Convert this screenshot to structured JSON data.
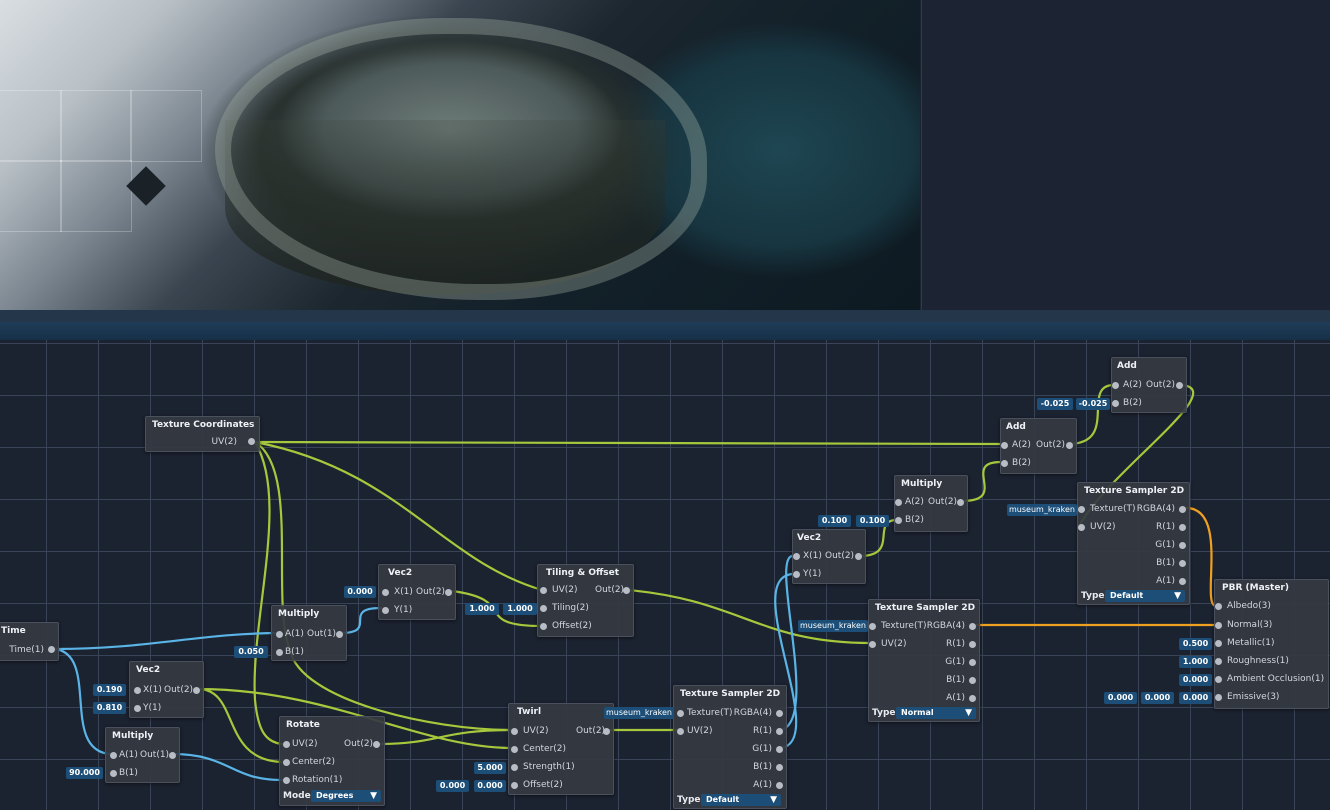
{
  "scene": {
    "viewport": "3D scene viewport"
  },
  "nodes": {
    "texcoords": {
      "title": "Texture Coordinates",
      "out": "UV(2)"
    },
    "time": {
      "title": "Time",
      "out": "Time(1)"
    },
    "vec2_a": {
      "title": "Vec2",
      "x": "X(1)",
      "y": "Y(1)",
      "out": "Out(2)",
      "x_val": "0.190",
      "y_val": "0.810"
    },
    "multiply_a": {
      "title": "Multiply",
      "a": "A(1)",
      "b": "B(1)",
      "out": "Out(1)",
      "b_val": "90.000"
    },
    "multiply_b": {
      "title": "Multiply",
      "a": "A(1)",
      "b": "B(1)",
      "out": "Out(1)",
      "b_val": "0.050"
    },
    "vec2_b": {
      "title": "Vec2",
      "x": "X(1)",
      "y": "Y(1)",
      "out": "Out(2)",
      "x_val": "0.000"
    },
    "rotate": {
      "title": "Rotate",
      "uv": "UV(2)",
      "center": "Center(2)",
      "rotation": "Rotation(1)",
      "out": "Out(2)",
      "mode_label": "Mode",
      "mode_value": "Degrees"
    },
    "tiling": {
      "title": "Tiling & Offset",
      "uv": "UV(2)",
      "tiling": "Tiling(2)",
      "offset": "Offset(2)",
      "out": "Out(2)",
      "tiling_x": "1.000",
      "tiling_y": "1.000"
    },
    "twirl": {
      "title": "Twirl",
      "uv": "UV(2)",
      "center": "Center(2)",
      "strength": "Strength(1)",
      "offset": "Offset(2)",
      "out": "Out(2)",
      "strength_val": "5.000",
      "offset_x": "0.000",
      "offset_y": "0.000"
    },
    "sampler_a": {
      "title": "Texture Sampler 2D",
      "texture": "Texture(T)",
      "uv": "UV(2)",
      "rgba": "RGBA(4)",
      "r": "R(1)",
      "g": "G(1)",
      "b": "B(1)",
      "a": "A(1)",
      "asset": "museum_kraken",
      "type_label": "Type",
      "type_value": "Default"
    },
    "vec2_c": {
      "title": "Vec2",
      "x": "X(1)",
      "y": "Y(1)",
      "out": "Out(2)"
    },
    "multiply_c": {
      "title": "Multiply",
      "a": "A(2)",
      "b": "B(2)",
      "out": "Out(2)",
      "a_val": "0.100",
      "b_val": "0.100"
    },
    "sampler_b": {
      "title": "Texture Sampler 2D",
      "texture": "Texture(T)",
      "uv": "UV(2)",
      "rgba": "RGBA(4)",
      "r": "R(1)",
      "g": "G(1)",
      "b": "B(1)",
      "a": "A(1)",
      "asset": "museum_kraken",
      "type_label": "Type",
      "type_value": "Normal"
    },
    "add_a": {
      "title": "Add",
      "a": "A(2)",
      "b": "B(2)",
      "out": "Out(2)"
    },
    "add_b": {
      "title": "Add",
      "a": "A(2)",
      "b": "B(2)",
      "out": "Out(2)",
      "a_val": "-0.025",
      "b_val": "-0.025"
    },
    "sampler_c": {
      "title": "Texture Sampler 2D",
      "texture": "Texture(T)",
      "uv": "UV(2)",
      "rgba": "RGBA(4)",
      "r": "R(1)",
      "g": "G(1)",
      "b": "B(1)",
      "a": "A(1)",
      "asset": "museum_kraken",
      "type_label": "Type",
      "type_value": "Default"
    },
    "pbr": {
      "title": "PBR (Master)",
      "albedo": "Albedo(3)",
      "normal": "Normal(3)",
      "metallic": "Metallic(1)",
      "roughness": "Roughness(1)",
      "ao": "Ambient Occlusion(1)",
      "emissive": "Emissive(3)",
      "metallic_val": "0.500",
      "roughness_val": "1.000",
      "ao_val": "0.000",
      "emissive_x": "0.000",
      "emissive_y": "0.000",
      "emissive_z": "0.000"
    }
  },
  "colors": {
    "wire_vec2": "#a6c83c",
    "wire_float": "#5ab4e6",
    "wire_vec4": "#f0a020",
    "value_box": "#1c4e78",
    "node_bg": "#343942",
    "grid": "#3a4458"
  }
}
